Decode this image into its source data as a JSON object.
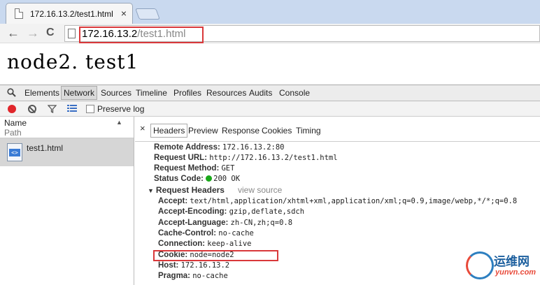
{
  "browser": {
    "tab_title": "172.16.13.2/test1.html",
    "tab_close": "×",
    "url_host": "172.16.13.2",
    "url_path": "/test1.html",
    "nav": {
      "back": "←",
      "forward": "→",
      "reload": "C"
    }
  },
  "page": {
    "heading": "node2. test1"
  },
  "devtools": {
    "tabs": [
      "Elements",
      "Network",
      "Sources",
      "Timeline",
      "Profiles",
      "Resources",
      "Audits",
      "Console"
    ],
    "active_tab": "Network",
    "preserve_log": "Preserve log",
    "columns": {
      "name": "Name",
      "path": "Path"
    },
    "requests": [
      {
        "name": "test1.html",
        "selected": true
      }
    ],
    "detail_tabs": [
      "Headers",
      "Preview",
      "Response",
      "Cookies",
      "Timing"
    ],
    "active_detail_tab": "Headers",
    "close": "×",
    "general": [
      {
        "key": "Remote Address:",
        "value": "172.16.13.2:80"
      },
      {
        "key": "Request URL:",
        "value": "http://172.16.13.2/test1.html"
      },
      {
        "key": "Request Method:",
        "value": "GET"
      },
      {
        "key": "Status Code:",
        "value": "200 OK"
      }
    ],
    "request_headers_title": "Request Headers",
    "view_source": "view source",
    "request_headers": [
      {
        "key": "Accept:",
        "value": "text/html,application/xhtml+xml,application/xml;q=0.9,image/webp,*/*;q=0.8"
      },
      {
        "key": "Accept-Encoding:",
        "value": "gzip,deflate,sdch"
      },
      {
        "key": "Accept-Language:",
        "value": "zh-CN,zh;q=0.8"
      },
      {
        "key": "Cache-Control:",
        "value": "no-cache"
      },
      {
        "key": "Connection:",
        "value": "keep-alive"
      },
      {
        "key": "Cookie:",
        "value": "node=node2"
      },
      {
        "key": "Host:",
        "value": "172.16.13.2"
      },
      {
        "key": "Pragma:",
        "value": "no-cache"
      }
    ]
  },
  "watermark": {
    "cn": "运维网",
    "en": "yunvn.com"
  },
  "colors": {
    "highlight": "#d9383a",
    "record": "#e0262b",
    "status_ok": "#1aa81a",
    "tabstrip": "#c9d9ef"
  }
}
